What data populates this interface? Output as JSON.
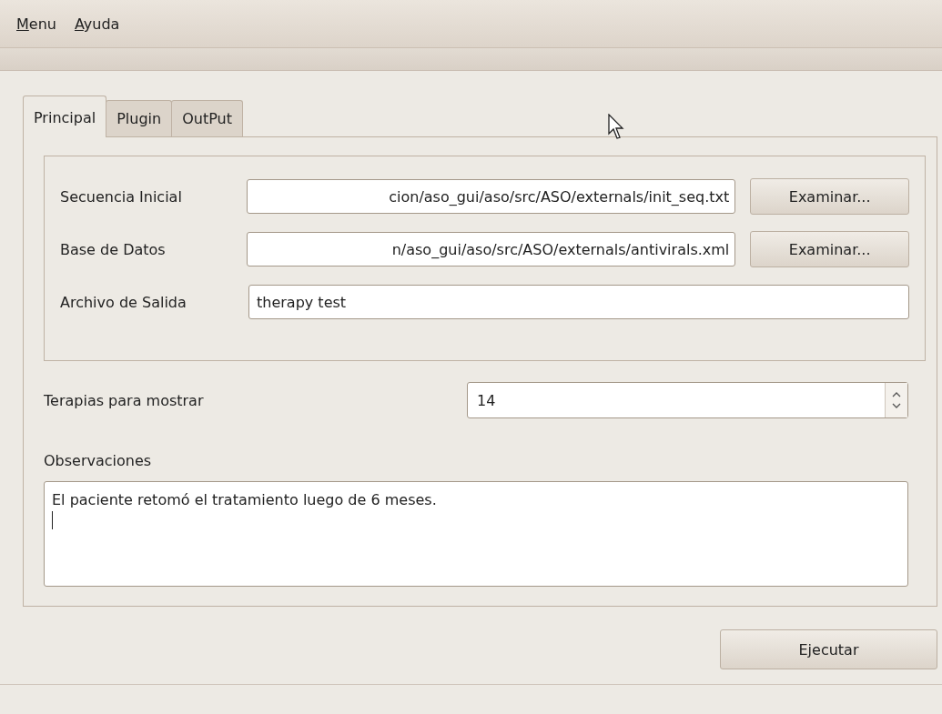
{
  "menu_bar": [
    {
      "label": "Menu",
      "mnemonic_underlined": true
    },
    {
      "label": "Ayuda",
      "mnemonic_underlined": true
    }
  ],
  "tabs": [
    {
      "label": "Principal",
      "selected": true
    },
    {
      "label": "Plugin",
      "selected": false
    },
    {
      "label": "OutPut",
      "selected": false
    }
  ],
  "files": [
    {
      "label": "Secuencia Inicial",
      "value": "cion/aso_gui/aso/src/ASO/externals/init_seq.txt",
      "button": "Examinar..."
    },
    {
      "label": "Base de Datos",
      "value": "n/aso_gui/aso/src/ASO/externals/antivirals.xml",
      "button": "Examinar..."
    },
    {
      "label": "Archivo de Salida",
      "value": "therapy test"
    }
  ],
  "therapies": {
    "label": "Terapias para mostrar",
    "value": "14"
  },
  "observations": {
    "label": "Observaciones",
    "value": "El paciente retomó el tratamiento luego de 6 meses."
  },
  "run_button": "Ejecutar"
}
